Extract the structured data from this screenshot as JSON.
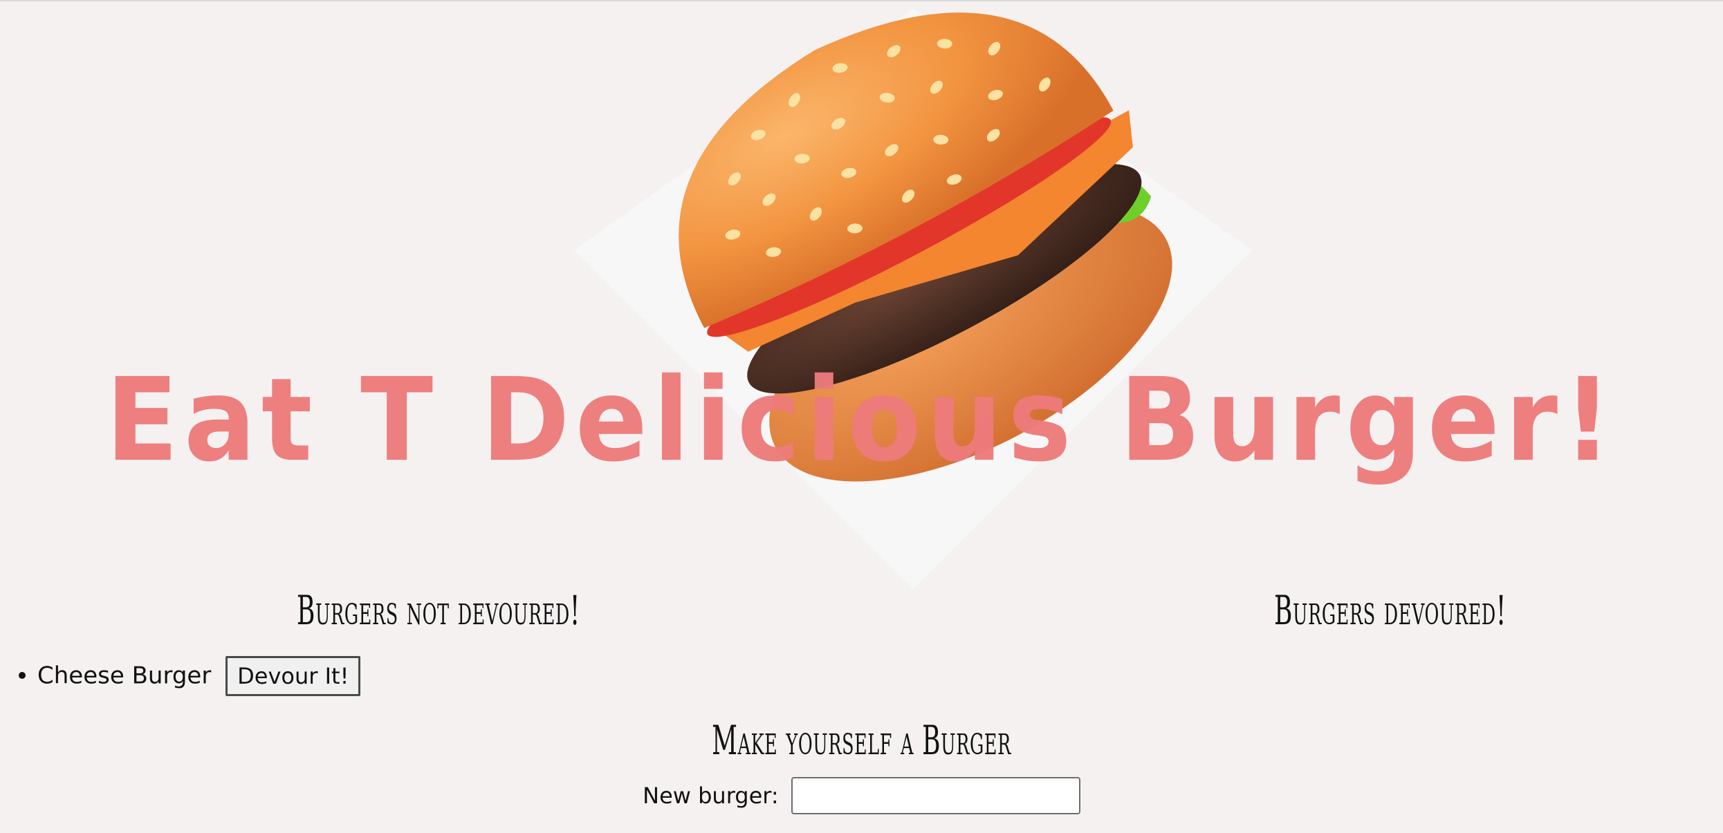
{
  "hero": {
    "title": "Eat T Delicious Burger!",
    "image": "burger-emoji"
  },
  "not_devoured": {
    "heading": "Burgers not devoured!",
    "items": [
      {
        "name": "Cheese Burger",
        "button_label": "Devour It!"
      }
    ]
  },
  "devoured": {
    "heading": "Burgers devoured!",
    "items": []
  },
  "form": {
    "heading": "Make yourself a Burger",
    "label": "New burger:",
    "value": "",
    "placeholder": ""
  },
  "colors": {
    "background": "#f5f1f1",
    "title": "#ee7b7b"
  }
}
